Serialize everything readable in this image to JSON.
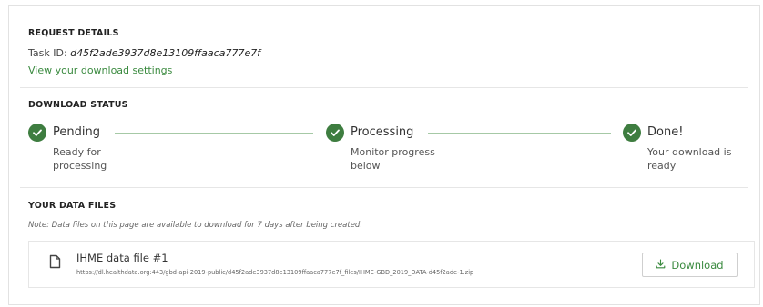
{
  "request": {
    "title": "REQUEST DETAILS",
    "task_label": "Task ID:",
    "task_id": "d45f2ade3937d8e13109ffaaca777e7f",
    "settings_link": "View your download settings"
  },
  "status": {
    "title": "DOWNLOAD STATUS",
    "steps": [
      {
        "label": "Pending",
        "desc_line1": "Ready for",
        "desc_line2": "processing",
        "icon": "check-circle-icon"
      },
      {
        "label": "Processing",
        "desc_line1": "Monitor progress",
        "desc_line2": "below",
        "icon": "check-circle-icon"
      },
      {
        "label": "Done!",
        "desc_line1": "Your download is",
        "desc_line2": "ready",
        "icon": "check-circle-icon"
      }
    ]
  },
  "files": {
    "title": "YOUR DATA FILES",
    "note": "Note: Data files on this page are available to download for 7 days after being created.",
    "items": [
      {
        "name": "IHME data file #1",
        "url": "https://dl.healthdata.org:443/gbd-api-2019-public/d45f2ade3937d8e13109ffaaca777e7f_files/IHME-GBD_2019_DATA-d45f2ade-1.zip",
        "button_label": "Download",
        "icon": "file-icon",
        "button_icon": "download-icon"
      }
    ]
  },
  "colors": {
    "accent_green": "#3e7d40",
    "link_green": "#3a8a3f",
    "line_green": "#a6c9a6"
  }
}
